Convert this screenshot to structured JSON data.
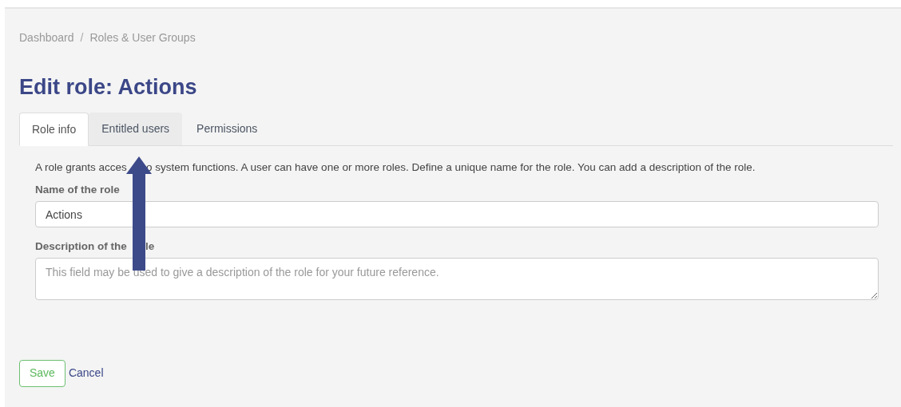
{
  "breadcrumb": [
    "Dashboard",
    "Roles & User Groups"
  ],
  "breadcrumb_separator": "/",
  "title": "Edit role: Actions",
  "tabs": [
    {
      "label": "Role info",
      "selected": true
    },
    {
      "label": "Entitled users",
      "selected": false
    },
    {
      "label": "Permissions",
      "selected": false
    }
  ],
  "intro": [
    "A role grants acces",
    "o system functions. A user can have one or more roles. Define a unique name for the role. You can add a description of the role."
  ],
  "name_field": {
    "label": "Name of the role",
    "value": "Actions"
  },
  "description_field": {
    "label": [
      "Description of the",
      "le"
    ],
    "placeholder": "This field may be used to give a description of the role for your future reference."
  },
  "buttons": {
    "save": "Save",
    "cancel": "Cancel"
  }
}
